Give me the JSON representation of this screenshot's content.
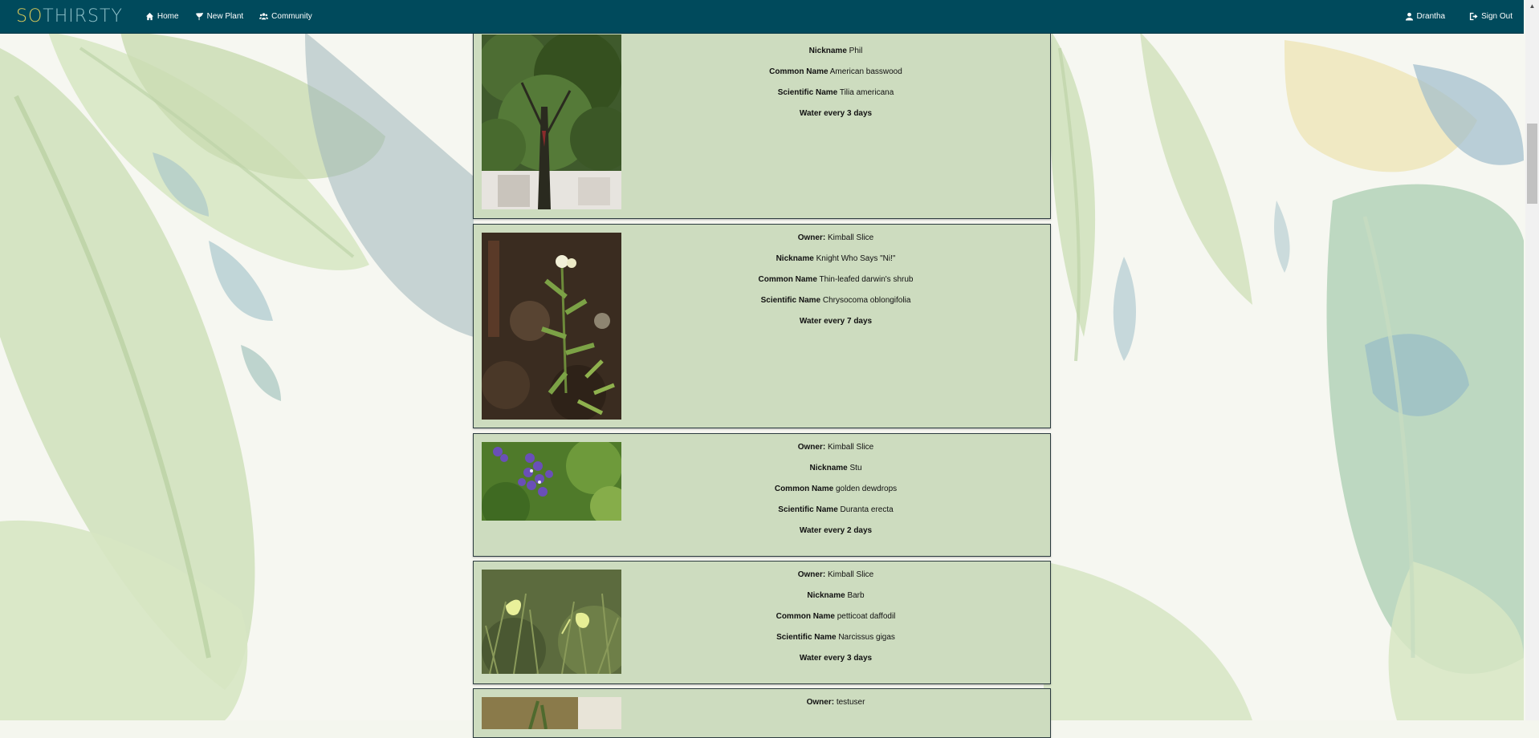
{
  "nav": {
    "brand_so": "SO",
    "brand_rest": "THIRSTY",
    "home": "Home",
    "new_plant": "New Plant",
    "community": "Community",
    "user": "Drantha",
    "sign_out": "Sign Out"
  },
  "labels": {
    "owner": "Owner:",
    "nickname": "Nickname",
    "common_name": "Common Name",
    "scientific_name": "Scientific Name"
  },
  "plants": [
    {
      "owner": "",
      "nickname": "Phil",
      "common_name": "American basswood",
      "scientific_name": "Tilia americana",
      "water": "Water every 3 days"
    },
    {
      "owner": "Kimball Slice",
      "nickname": "Knight Who Says \"Ni!\"",
      "common_name": "Thin-leafed darwin's shrub",
      "scientific_name": "Chrysocoma oblongifolia",
      "water": "Water every 7 days"
    },
    {
      "owner": "Kimball Slice",
      "nickname": "Stu",
      "common_name": "golden dewdrops",
      "scientific_name": "Duranta erecta",
      "water": "Water every 2 days"
    },
    {
      "owner": "Kimball Slice",
      "nickname": "Barb",
      "common_name": "petticoat daffodil",
      "scientific_name": "Narcissus gigas",
      "water": "Water every 3 days"
    },
    {
      "owner": "testuser"
    }
  ],
  "colors": {
    "navbar": "#004a5c",
    "card_bg": "#cddcbf",
    "card_border": "#2c3b3f"
  }
}
